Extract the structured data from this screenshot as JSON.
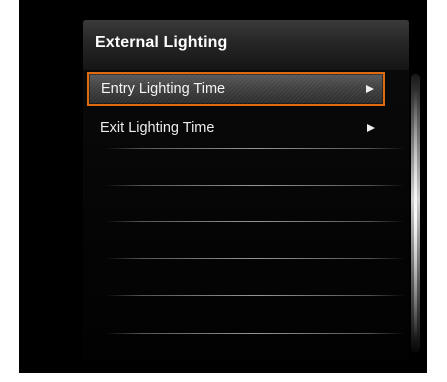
{
  "screen": {
    "title": "External Lighting",
    "menu_items": [
      {
        "label": "Entry Lighting Time",
        "selected": true,
        "arrow_icon": "right-triangle-arrow"
      },
      {
        "label": "Exit Lighting Time",
        "selected": false,
        "arrow_icon": "right-triangle-arrow"
      }
    ],
    "colors": {
      "selection_border": "#e06a10",
      "background": "#000000",
      "text": "#ffffff"
    }
  }
}
